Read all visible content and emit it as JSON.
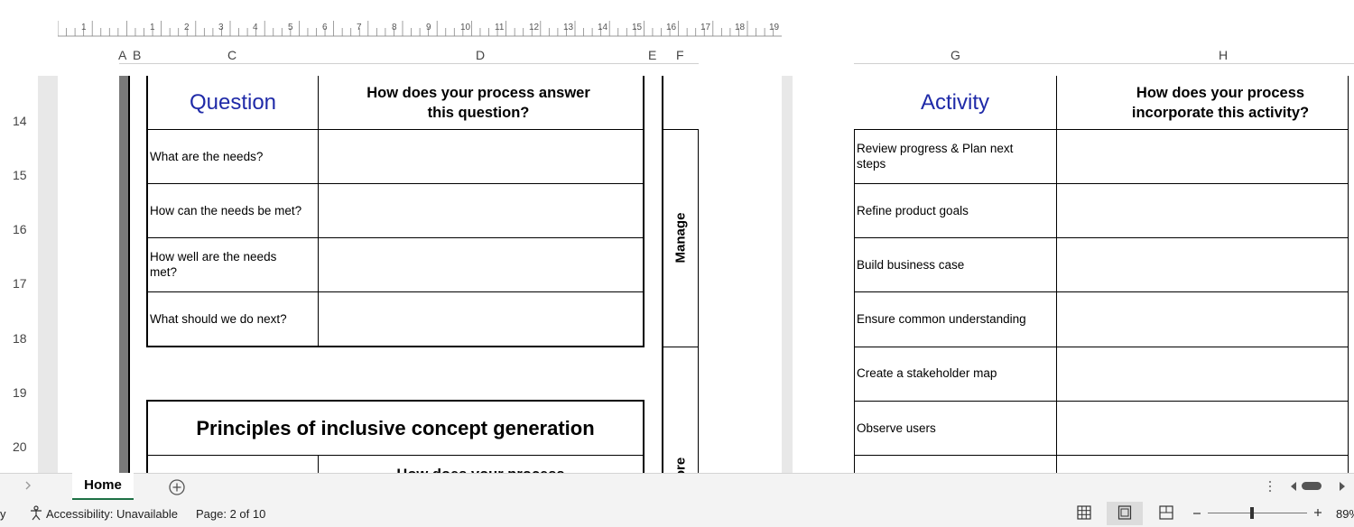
{
  "ruler": {
    "ticks": [
      "1",
      "1",
      "2",
      "3",
      "4",
      "5",
      "6",
      "7",
      "8",
      "9",
      "10",
      "11",
      "12",
      "13",
      "14",
      "15",
      "16",
      "17",
      "18",
      "19"
    ]
  },
  "columns": [
    "A",
    "B",
    "C",
    "D",
    "E",
    "F",
    "G",
    "H"
  ],
  "rows": [
    "14",
    "15",
    "16",
    "17",
    "18",
    "19",
    "20"
  ],
  "left_table": {
    "col1_header": "Question",
    "col2_header": "How does your process answer this question?",
    "items": [
      "What are the needs?",
      "How can the needs be met?",
      "How well are the needs met?",
      "What should we do next?"
    ]
  },
  "section2": {
    "title": "Principles of inclusive concept generation",
    "partial_header": "How does your process"
  },
  "vertical_labels": {
    "manage": "Manage",
    "explore_partial": "ore"
  },
  "right_table": {
    "col1_header": "Activity",
    "col2_header": "How does your process incorporate this activity?",
    "items": [
      "Review progress & Plan next steps",
      "Refine product goals",
      "Build business case",
      "Ensure common understanding",
      "Create a stakeholder map",
      "Observe users"
    ]
  },
  "sheet_tabs": {
    "active": "Home",
    "add_label": "+"
  },
  "status": {
    "left_fragment": "y",
    "accessibility": "Accessibility: Unavailable",
    "page": "Page: 2 of 10",
    "zoom": "89%"
  },
  "colors": {
    "accent": "#1f2aa8",
    "tab_underline": "#1e7145"
  }
}
